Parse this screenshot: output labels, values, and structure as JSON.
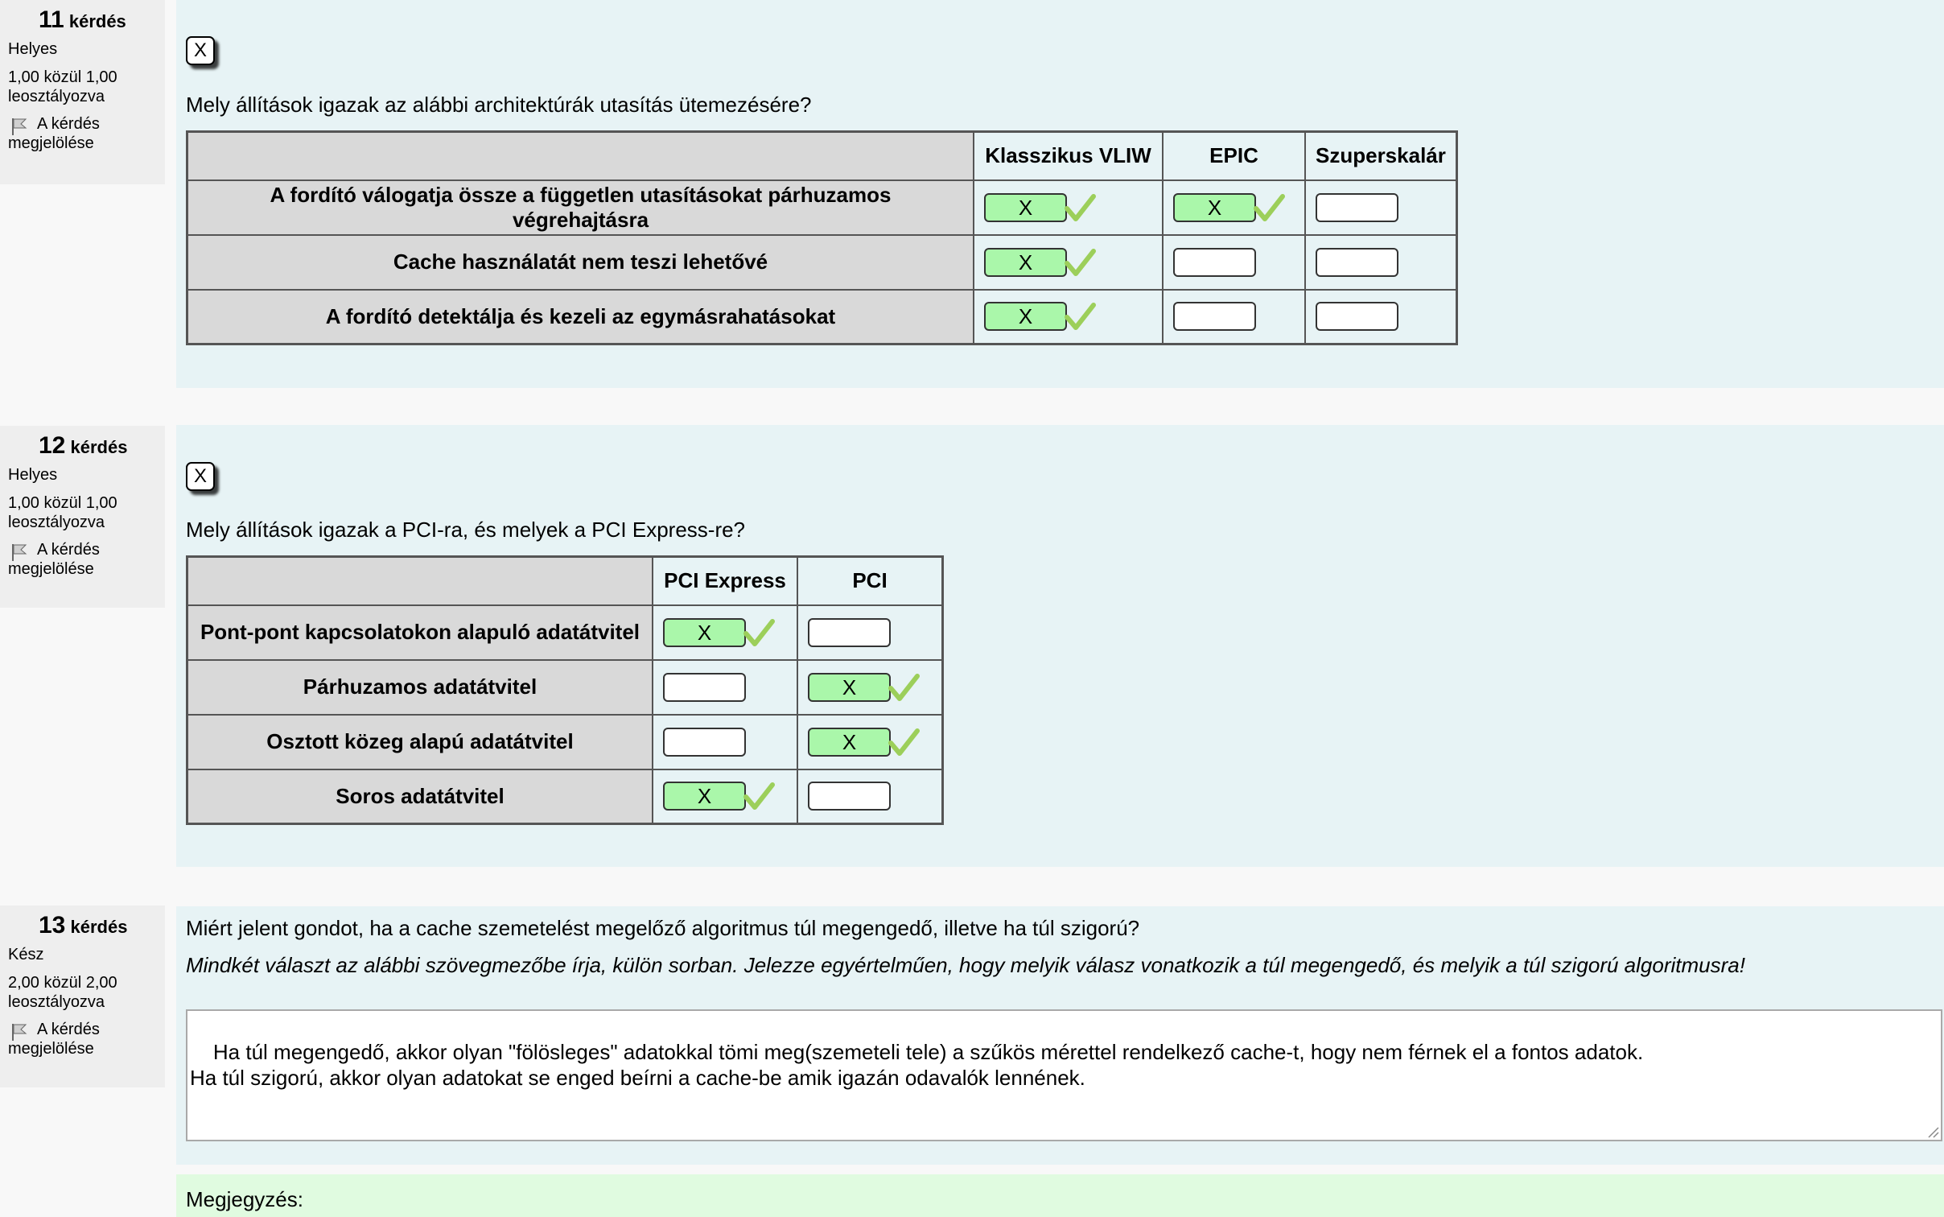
{
  "questions": [
    {
      "number": "11",
      "number_suffix": "kérdés",
      "state": "Helyes",
      "grade_line1": "1,00 közül 1,00",
      "grade_line2": "leosztályozva",
      "flag_line1": "A kérdés",
      "flag_line2": "megjelölése",
      "close_label": "X",
      "text": "Mely állítások igazak az alábbi architektúrák utasítás ütemezésére?",
      "columns": [
        "Klasszikus VLIW",
        "EPIC",
        "Szuperskalár"
      ],
      "rows": [
        {
          "label": "A fordító válogatja össze a független utasításokat párhuzamos végrehajtásra",
          "cells": [
            "X",
            "X",
            ""
          ]
        },
        {
          "label": "Cache használatát nem teszi lehetővé",
          "cells": [
            "X",
            "",
            ""
          ]
        },
        {
          "label": "A fordító detektálja és kezeli az egymásrahatásokat",
          "cells": [
            "X",
            "",
            ""
          ]
        }
      ]
    },
    {
      "number": "12",
      "number_suffix": "kérdés",
      "state": "Helyes",
      "grade_line1": "1,00 közül 1,00",
      "grade_line2": "leosztályozva",
      "flag_line1": "A kérdés",
      "flag_line2": "megjelölése",
      "close_label": "X",
      "text": "Mely állítások igazak a PCI-ra, és melyek a PCI Express-re?",
      "columns": [
        "PCI Express",
        "PCI"
      ],
      "rows": [
        {
          "label": "Pont-pont kapcsolatokon alapuló adatátvitel",
          "cells": [
            "X",
            ""
          ]
        },
        {
          "label": "Párhuzamos adatátvitel",
          "cells": [
            "",
            "X"
          ]
        },
        {
          "label": "Osztott közeg alapú adatátvitel",
          "cells": [
            "",
            "X"
          ]
        },
        {
          "label": "Soros adatátvitel",
          "cells": [
            "X",
            ""
          ]
        }
      ]
    },
    {
      "number": "13",
      "number_suffix": "kérdés",
      "state": "Kész",
      "grade_line1": "2,00 közül 2,00",
      "grade_line2": "leosztályozva",
      "flag_line1": "A kérdés",
      "flag_line2": "megjelölése",
      "text": "Miért jelent gondot, ha a cache szemetelést megelőző algoritmus túl megengedő, illetve ha túl szigorú?",
      "instruction": "Mindkét választ az alábbi szövegmezőbe írja, külön sorban. Jelezze egyértelműen, hogy melyik válasz vonatkozik a túl megengedő, és melyik a túl szigorú algoritmusra!",
      "answer": "Ha túl megengedő, akkor olyan \"fölösleges\" adatokkal tömi meg(szemeteli tele) a szűkös mérettel rendelkező cache-t, hogy nem férnek el a fontos adatok.\nHa túl szigorú, akkor olyan adatokat se enged beírni a cache-be amik igazán odavalók lennének."
    }
  ],
  "comment_label": "Megjegyzés:",
  "colors": {
    "info_bg": "#eeeeee",
    "content_bg": "#e7f3f5",
    "selected_bg": "#aaf7aa",
    "tick": "#9ccf5a",
    "header_bg": "#d9d9d9",
    "comment_bg": "#e0fbe0"
  },
  "icons": {
    "flag": "flag-icon",
    "tick": "correct-tick-icon",
    "close": "close-icon",
    "resize": "resize-grip-icon"
  }
}
